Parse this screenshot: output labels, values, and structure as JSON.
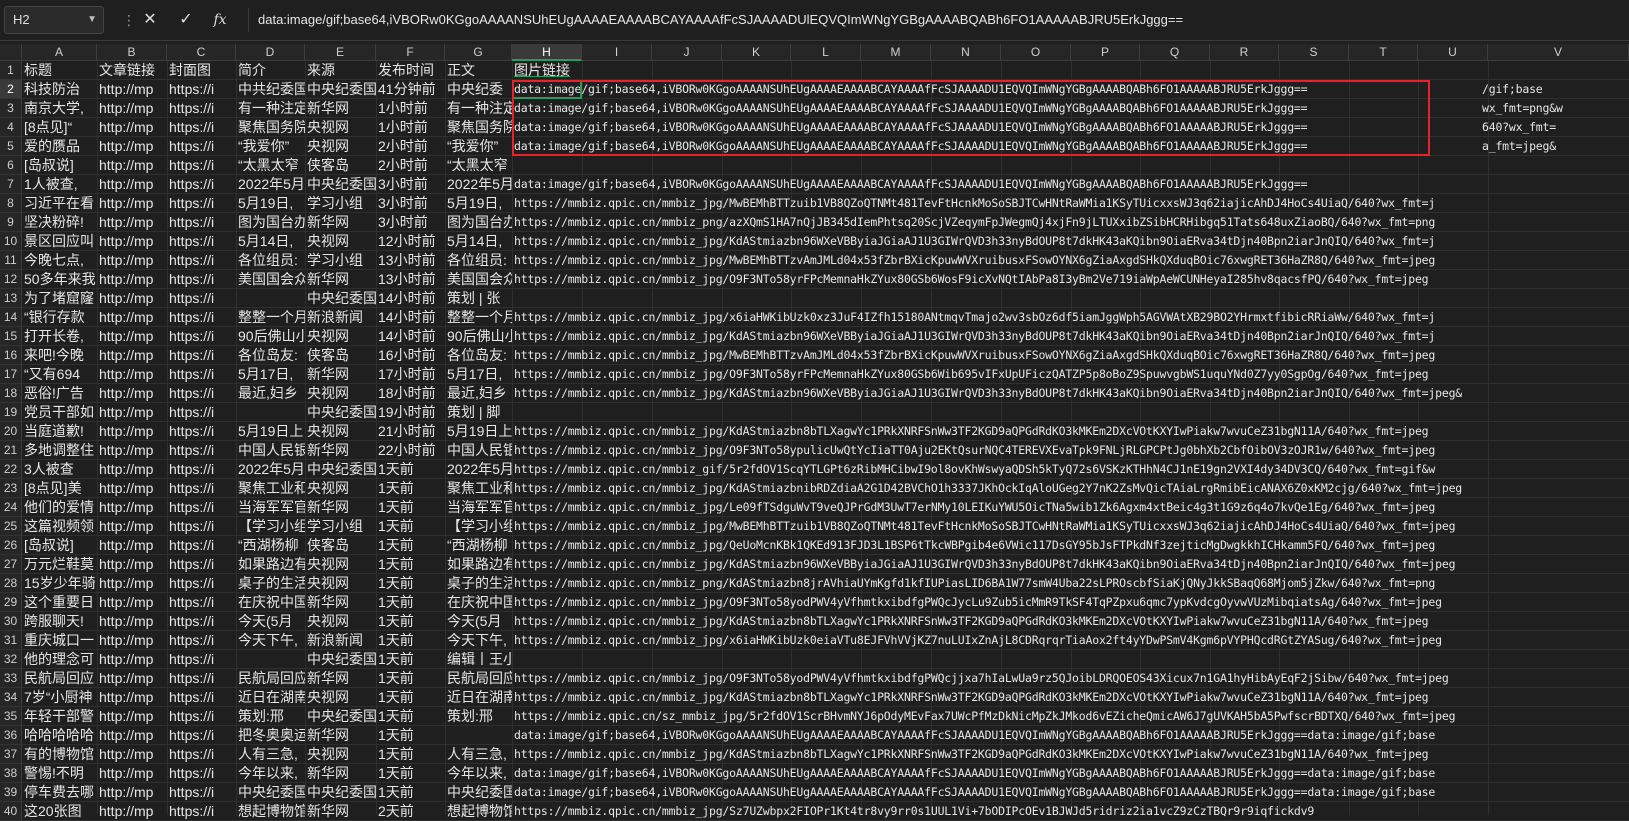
{
  "name_box": {
    "value": "H2"
  },
  "formula_bar": {
    "content": "data:image/gif;base64,iVBORw0KGgoAAAANSUhEUgAAAAEAAAABCAYAAAAfFcSJAAAADUlEQVQImWNgYGBgAAAABQABh6FO1AAAAABJRU5ErkJggg==",
    "cancel_icon": "close-icon",
    "enter_icon": "check-icon",
    "function_icon": "fx-icon"
  },
  "columns": [
    "A",
    "B",
    "C",
    "D",
    "E",
    "F",
    "G",
    "H",
    "I",
    "J",
    "K",
    "L",
    "M",
    "N",
    "O",
    "P",
    "Q",
    "R",
    "S",
    "T",
    "U",
    "V"
  ],
  "selected_column": "H",
  "highlight_color": "#e8222a",
  "selection_color": "#2e9a57",
  "rows": [
    {
      "n": "1",
      "a": "标题",
      "b": "文章链接",
      "c": "封面图",
      "d": "简介",
      "e": "来源",
      "f": "发布时间",
      "g": "正文",
      "h": "图片链接",
      "v": ""
    },
    {
      "n": "2",
      "a": "科技防治",
      "b": "http://mp",
      "c": "https://i",
      "d": "中共纪委国",
      "e": "中央纪委国",
      "f": "41分钟前",
      "g": "中央纪委",
      "h": "data:image/gif;base64,iVBORw0KGgoAAAANSUhEUgAAAAEAAAABCAYAAAAfFcSJAAAADU1EQVQImWNgYGBgAAAABQABh6FO1AAAAABJRU5ErkJggg==",
      "v": "/gif;base"
    },
    {
      "n": "3",
      "a": "南京大学,",
      "b": "http://mp",
      "c": "https://i",
      "d": "有一种注定",
      "e": "新华网",
      "f": "1小时前",
      "g": "有一种注定",
      "h": "data:image/gif;base64,iVBORw0KGgoAAAANSUhEUgAAAAEAAAABCAYAAAAfFcSJAAAADU1EQVQImWNgYGBgAAAABQABh6FO1AAAAABJRU5ErkJggg==",
      "v": "wx_fmt=png&w"
    },
    {
      "n": "4",
      "a": "[8点见]“",
      "b": "http://mp",
      "c": "https://i",
      "d": "聚焦国务院",
      "e": "央视网",
      "f": "1小时前",
      "g": "聚焦国务院",
      "h": "data:image/gif;base64,iVBORw0KGgoAAAANSUhEUgAAAAEAAAABCAYAAAAfFcSJAAAADU1EQVQImWNgYGBgAAAABQABh6FO1AAAAABJRU5ErkJggg==",
      "v": "640?wx_fmt="
    },
    {
      "n": "5",
      "a": "爱的赝品",
      "b": "http://mp",
      "c": "https://i",
      "d": "“我爱你”",
      "e": "央视网",
      "f": "2小时前",
      "g": "“我爱你”",
      "h": "data:image/gif;base64,iVBORw0KGgoAAAANSUhEUgAAAAEAAAABCAYAAAAfFcSJAAAADU1EQVQImWNgYGBgAAAABQABh6FO1AAAAABJRU5ErkJggg==",
      "v": "a_fmt=jpeg&"
    },
    {
      "n": "6",
      "a": "[岛叔说]",
      "b": "http://mp",
      "c": "https://i",
      "d": "“太黑太窄",
      "e": "侠客岛",
      "f": "2小时前",
      "g": "“太黑太窄",
      "h": "",
      "v": ""
    },
    {
      "n": "7",
      "a": "1人被查,",
      "b": "http://mp",
      "c": "https://i",
      "d": "2022年5月",
      "e": "中央纪委国",
      "f": "3小时前",
      "g": "2022年5月",
      "h": "data:image/gif;base64,iVBORw0KGgoAAAANSUhEUgAAAAEAAAABCAYAAAAfFcSJAAAADU1EQVQImWNgYGBgAAAABQABh6FO1AAAAABJRU5ErkJggg==",
      "v": ""
    },
    {
      "n": "8",
      "a": "习近平在看",
      "b": "http://mp",
      "c": "https://i",
      "d": "5月19日,",
      "e": "学习小组",
      "f": "3小时前",
      "g": "5月19日,",
      "h": "https://mmbiz.qpic.cn/mmbiz_jpg/MwBEMhBTTzuib1VB8QZoQTNMt481TevFtHcnkMoSoSBJTCwHNtRaWMia1KSyTUicxxsWJ3q62iajicAhDJ4HoCs4UiaQ/640?wx_fmt=j",
      "v": ""
    },
    {
      "n": "9",
      "a": "坚决粉碎!",
      "b": "http://mp",
      "c": "https://i",
      "d": "图为国台办",
      "e": "新华网",
      "f": "3小时前",
      "g": "图为国台办",
      "h": "https://mmbiz.qpic.cn/mmbiz_png/azXQmS1HA7nQjJB345dIemPhtsq20ScjVZeqymFpJWegmQj4xjFn9jLTUXxibZSibHCRHibgq51Tats648uxZiaoBQ/640?wx_fmt=png",
      "v": ""
    },
    {
      "n": "10",
      "a": "景区回应叫",
      "b": "http://mp",
      "c": "https://i",
      "d": "5月14日,",
      "e": "央视网",
      "f": "12小时前",
      "g": "5月14日,",
      "h": "https://mmbiz.qpic.cn/mmbiz_jpg/KdAStmiazbn96WXeVBByiaJGiaAJ1U3GIWrQVD3h33nyBdOUP8t7dkHK43aKQibn9OiaERva34tDjn40Bpn2iarJnQIQ/640?wx_fmt=j",
      "v": ""
    },
    {
      "n": "11",
      "a": "今晚七点,",
      "b": "http://mp",
      "c": "https://i",
      "d": "各位组员:",
      "e": "学习小组",
      "f": "13小时前",
      "g": "各位组员:",
      "h": "https://mmbiz.qpic.cn/mmbiz_jpg/MwBEMhBTTzvAmJMLd04x53fZbrBXicKpuwWVXruibusxFSowOYNX6gZiaAxgdSHkQXduqBOic76xwgRET36HaZR8Q/640?wx_fmt=jpeg",
      "v": ""
    },
    {
      "n": "12",
      "a": "50多年来我",
      "b": "http://mp",
      "c": "https://i",
      "d": "美国国会众",
      "e": "新华网",
      "f": "13小时前",
      "g": "美国国会众",
      "h": "https://mmbiz.qpic.cn/mmbiz_jpg/O9F3NTo58yrFPcMemnaHkZYux80GSb6WosF9icXvNQtIAbPa8I3yBm2Ve719iaWpAeWCUNHeyaI285hv8qacsfPQ/640?wx_fmt=jpeg",
      "v": ""
    },
    {
      "n": "13",
      "a": "为了堵窟窿",
      "b": "http://mp",
      "c": "https://i",
      "d": "",
      "e": "中央纪委国",
      "f": "14小时前",
      "g": "策划 | 张",
      "h": "",
      "v": ""
    },
    {
      "n": "14",
      "a": "“银行存款",
      "b": "http://mp",
      "c": "https://i",
      "d": "整整一个月",
      "e": "新浪新闻",
      "f": "14小时前",
      "g": "整整一个月",
      "h": "https://mmbiz.qpic.cn/mmbiz_jpg/x6iaHWKibUzk0xz3JuF4IZfh15180ANtmqvTmajo2wv3sbOz6df5iamJggWph5AGVWAtXB29BO2YHrmxtfibicRRiaWw/640?wx_fmt=j",
      "v": ""
    },
    {
      "n": "15",
      "a": "打开长卷,",
      "b": "http://mp",
      "c": "https://i",
      "d": "90后佛山小",
      "e": "央视网",
      "f": "14小时前",
      "g": "90后佛山小",
      "h": "https://mmbiz.qpic.cn/mmbiz_jpg/KdAStmiazbn96WXeVBByiaJGiaAJ1U3GIWrQVD3h33nyBdOUP8t7dkHK43aKQibn9OiaERva34tDjn40Bpn2iarJnQIQ/640?wx_fmt=j",
      "v": ""
    },
    {
      "n": "16",
      "a": "来吧!今晚",
      "b": "http://mp",
      "c": "https://i",
      "d": "各位岛友:",
      "e": "侠客岛",
      "f": "16小时前",
      "g": "各位岛友:",
      "h": "https://mmbiz.qpic.cn/mmbiz_jpg/MwBEMhBTTzvAmJMLd04x53fZbrBXicKpuwWVXruibusxFSowOYNX6gZiaAxgdSHkQXduqBOic76xwgRET36HaZR8Q/640?wx_fmt=jpeg",
      "v": ""
    },
    {
      "n": "17",
      "a": "“又有694",
      "b": "http://mp",
      "c": "https://i",
      "d": "5月17日,",
      "e": "新华网",
      "f": "17小时前",
      "g": "5月17日,",
      "h": "https://mmbiz.qpic.cn/mmbiz_jpg/O9F3NTo58yrFPcMemnaHkZYux80GSb6Wib695vIFxUpUFiczQATZP5p8oBoZ9SpuwvgbWS1uquYNd0Z7yy0SgpOg/640?wx_fmt=jpeg",
      "v": ""
    },
    {
      "n": "18",
      "a": "恶俗!广告",
      "b": "http://mp",
      "c": "https://i",
      "d": "最近,妇乡",
      "e": "央视网",
      "f": "18小时前",
      "g": "最近,妇乡",
      "h": "https://mmbiz.qpic.cn/mmbiz_jpg/KdAStmiazbn96WXeVBByiaJGiaAJ1U3GIWrQVD3h33nyBdOUP8t7dkHK43aKQibn9OiaERva34tDjn40Bpn2iarJnQIQ/640?wx_fmt=jpeg&",
      "v": ""
    },
    {
      "n": "19",
      "a": "党员干部如",
      "b": "http://mp",
      "c": "https://i",
      "d": "",
      "e": "中央纪委国",
      "f": "19小时前",
      "g": "策划 | 脚",
      "h": "",
      "v": ""
    },
    {
      "n": "20",
      "a": "当庭道歉!",
      "b": "http://mp",
      "c": "https://i",
      "d": "5月19日上",
      "e": "央视网",
      "f": "21小时前",
      "g": "5月19日上",
      "h": "https://mmbiz.qpic.cn/mmbiz_jpg/KdAStmiazbn8bTLXagwYc1PRkXNRFSnWw3TF2KGD9aQPGdRdKO3kMKEm2DXcVOtKXYIwPiakw7wvuCeZ31bgN11A/640?wx_fmt=jpeg",
      "v": ""
    },
    {
      "n": "21",
      "a": "多地调整住",
      "b": "http://mp",
      "c": "https://i",
      "d": "中国人民银",
      "e": "新华网",
      "f": "22小时前",
      "g": "中国人民银",
      "h": "https://mmbiz.qpic.cn/mmbiz_jpg/O9F3NTo58ypulicUwQtYcIiaTT0Aju2EKtQsurNQC4TEREVXEvaTpk9FNLjRLGPCPtJg0bhXb2CbfOibOV3zOJR1w/640?wx_fmt=jpeg",
      "v": ""
    },
    {
      "n": "22",
      "a": "3人被查",
      "b": "http://mp",
      "c": "https://i",
      "d": "2022年5月",
      "e": "中央纪委国",
      "f": "1天前",
      "g": "2022年5月",
      "h": "https://mmbiz.qpic.cn/mmbiz_gif/5r2fdOV1ScqYTLGPt6zRibMHCibwI9ol8ovKhWswyaQDSh5kTyQ72s6VSKzKTHhN4CJ1nE19gn2VXI4dy34DV3CQ/640?wx_fmt=gif&w",
      "v": ""
    },
    {
      "n": "23",
      "a": "[8点见]美",
      "b": "http://mp",
      "c": "https://i",
      "d": "聚焦工业和",
      "e": "央视网",
      "f": "1天前",
      "g": "聚焦工业和",
      "h": "https://mmbiz.qpic.cn/mmbiz_jpg/KdAStmiazbnibRDZdiaA2G1D42BVChO1h3337JKhOckIqAloUGeg2Y7nK2ZsMvQicTAiaLrgRmibEicANAX6Z0xKM2cjg/640?wx_fmt=jpeg",
      "v": ""
    },
    {
      "n": "24",
      "a": "他们的爱情",
      "b": "http://mp",
      "c": "https://i",
      "d": "当海军军官",
      "e": "新华网",
      "f": "1天前",
      "g": "当海军军官",
      "h": "https://mmbiz.qpic.cn/mmbiz_jpg/Le09fTSdguWvT9veQJPrGdM3UwT7erNMy10LEIKuYWU5OicTNa5wib1Zk6Agxm4xtBeic4g3t1G9z6q4o7kvQe1Eg/640?wx_fmt=jpeg",
      "v": ""
    },
    {
      "n": "25",
      "a": "这篇视频领",
      "b": "http://mp",
      "c": "https://i",
      "d": "【学习小组",
      "e": "学习小组",
      "f": "1天前",
      "g": "【学习小组",
      "h": "https://mmbiz.qpic.cn/mmbiz_jpg/MwBEMhBTTzuib1VB8QZoQTNMt481TevFtHcnkMoSoSBJTCwHNtRaWMia1KSyTUicxxsWJ3q62iajicAhDJ4HoCs4UiaQ/640?wx_fmt=jpeg",
      "v": ""
    },
    {
      "n": "26",
      "a": "[岛叔说]",
      "b": "http://mp",
      "c": "https://i",
      "d": "“西湖杨柳",
      "e": "侠客岛",
      "f": "1天前",
      "g": "“西湖杨柳",
      "h": "https://mmbiz.qpic.cn/mmbiz_jpg/QeUoMcnKBk1QKEd913FJD3L1BSP6tTkcWBPgib4e6VWic117DsGY95bJsFTPkdNf3zejticMgDwgkkhICHkamm5FQ/640?wx_fmt=jpeg",
      "v": ""
    },
    {
      "n": "27",
      "a": "万元烂鞋莫",
      "b": "http://mp",
      "c": "https://i",
      "d": "如果路边有",
      "e": "央视网",
      "f": "1天前",
      "g": "如果路边有",
      "h": "https://mmbiz.qpic.cn/mmbiz_jpg/KdAStmiazbn96WXeVBByiaJGiaAJ1U3GIWrQVD3h33nyBdOUP8t7dkHK43aKQibn9OiaERva34tDjn40Bpn2iarJnQIQ/640?wx_fmt=jpeg",
      "v": ""
    },
    {
      "n": "28",
      "a": "15岁少年骑",
      "b": "http://mp",
      "c": "https://i",
      "d": "桌子的生活",
      "e": "央视网",
      "f": "1天前",
      "g": "桌子的生活",
      "h": "https://mmbiz.qpic.cn/mmbiz_png/KdAStmiazbn8jrAVhiaUYmKgfd1kfIUPiasLID6BA1W77smW4Uba22sLPROscbfSiaKjQNyJkkSBaqQ68Mjom5jZkw/640?wx_fmt=png",
      "v": ""
    },
    {
      "n": "29",
      "a": "这个重要日",
      "b": "http://mp",
      "c": "https://i",
      "d": "在庆祝中国",
      "e": "新华网",
      "f": "1天前",
      "g": "在庆祝中国",
      "h": "https://mmbiz.qpic.cn/mmbiz_jpg/O9F3NTo58yodPWV4yVfhmtkxibdfgPWQcJycLu9Zub5icMmR9TkSF4TqPZpxu6qmc7ypKvdcgOyvwVUzMibqiatsAg/640?wx_fmt=jpeg",
      "v": ""
    },
    {
      "n": "30",
      "a": "跨服聊天!",
      "b": "http://mp",
      "c": "https://i",
      "d": "今天(5月",
      "e": "央视网",
      "f": "1天前",
      "g": "今天(5月",
      "h": "https://mmbiz.qpic.cn/mmbiz_jpg/KdAStmiazbn8bTLXagwYc1PRkXNRFSnWw3TF2KGD9aQPGdRdKO3kMKEm2DXcVOtKXYIwPiakw7wvuCeZ31bgN11A/640?wx_fmt=jpeg",
      "v": ""
    },
    {
      "n": "31",
      "a": "重庆城口一",
      "b": "http://mp",
      "c": "https://i",
      "d": "今天下午,",
      "e": "新浪新闻",
      "f": "1天前",
      "g": "今天下午,",
      "h": "https://mmbiz.qpic.cn/mmbiz_jpg/x6iaHWKibUzk0eiaVTu8EJFVhVVjKZ7nuLUIxZnAjL8CDRqrqrTiaAox2ft4yYDwPSmV4Kgm6pVYPHQcdRGtZYASug/640?wx_fmt=jpeg",
      "v": ""
    },
    {
      "n": "32",
      "a": "他的理念可",
      "b": "http://mp",
      "c": "https://i",
      "d": "",
      "e": "中央纪委国",
      "f": "1天前",
      "g": "编辑丨王小",
      "h": "",
      "v": ""
    },
    {
      "n": "33",
      "a": "民航局回应",
      "b": "http://mp",
      "c": "https://i",
      "d": "民航局回应",
      "e": "新华网",
      "f": "1天前",
      "g": "民航局回应",
      "h": "https://mmbiz.qpic.cn/mmbiz_jpg/O9F3NTo58yodPWV4yVfhmtkxibdfgPWQcjjxa7hIaLwUa9rz5QJoibLDRQOEOS43Xicux7n1GA1hyHibAyEqF2jSibw/640?wx_fmt=jpeg",
      "v": ""
    },
    {
      "n": "34",
      "a": "7岁“小厨神",
      "b": "http://mp",
      "c": "https://i",
      "d": "近日在湖南",
      "e": "央视网",
      "f": "1天前",
      "g": "近日在湖南",
      "h": "https://mmbiz.qpic.cn/mmbiz_jpg/KdAStmiazbn8bTLXagwYc1PRkXNRFSnWw3TF2KGD9aQPGdRdKO3kMKEm2DXcVOtKXYIwPiakw7wvuCeZ31bgN11A/640?wx_fmt=jpeg",
      "v": ""
    },
    {
      "n": "35",
      "a": "年轻干部警",
      "b": "http://mp",
      "c": "https://i",
      "d": "策划:邢",
      "e": "中央纪委国",
      "f": "1天前",
      "g": "策划:邢",
      "h": "https://mmbiz.qpic.cn/sz_mmbiz_jpg/5r2fdOV1ScrBHvmNYJ6pOdyMEvFax7UWcPfMzDkNicMpZkJMkod6vEZicheQmicAW6J7gUVKAH5bA5PwfscrBDTXQ/640?wx_fmt=jpeg",
      "v": ""
    },
    {
      "n": "36",
      "a": "哈哈哈哈哈",
      "b": "http://mp",
      "c": "https://i",
      "d": "把冬奥奥运",
      "e": "新华网",
      "f": "1天前",
      "g": "",
      "h": "data:image/gif;base64,iVBORw0KGgoAAAANSUhEUgAAAAEAAAABCAYAAAAfFcSJAAAADU1EQVQImWNgYGBgAAAABQABh6FO1AAAAABJRU5ErkJggg==data:image/gif;base",
      "v": ""
    },
    {
      "n": "37",
      "a": "有的博物馆",
      "b": "http://mp",
      "c": "https://i",
      "d": "人有三急,",
      "e": "央视网",
      "f": "1天前",
      "g": "人有三急,",
      "h": "https://mmbiz.qpic.cn/mmbiz_jpg/KdAStmiazbn8bTLXagwYc1PRkXNRFSnWw3TF2KGD9aQPGdRdKO3kMKEm2DXcVOtKXYIwPiakw7wvuCeZ31bgN11A/640?wx_fmt=jpeg",
      "v": ""
    },
    {
      "n": "38",
      "a": "警惕!不明",
      "b": "http://mp",
      "c": "https://i",
      "d": "今年以来,",
      "e": "新华网",
      "f": "1天前",
      "g": "今年以来,",
      "h": "data:image/gif;base64,iVBORw0KGgoAAAANSUhEUgAAAAEAAAABCAYAAAAfFcSJAAAADU1EQVQImWNgYGBgAAAABQABh6FO1AAAAABJRU5ErkJggg==data:image/gif;base",
      "v": ""
    },
    {
      "n": "39",
      "a": "停车费去哪",
      "b": "http://mp",
      "c": "https://i",
      "d": "中央纪委国",
      "e": "中央纪委国",
      "f": "1天前",
      "g": "中央纪委国",
      "h": "data:image/gif;base64,iVBORw0KGgoAAAANSUhEUgAAAAEAAAABCAYAAAAfFcSJAAAADU1EQVQImWNgYGBgAAAABQABh6FO1AAAAABJRU5ErkJggg==data:image/gif;base",
      "v": ""
    },
    {
      "n": "40",
      "a": "这20张图",
      "b": "http://mp",
      "c": "https://i",
      "d": "想起博物馆",
      "e": "新华网",
      "f": "2天前",
      "g": "想起博物馆",
      "h": "https://mmbiz.qpic.cn/mmbiz_jpg/Sz7UZwbpx2FIOPr1Kt4tr8vy9rr0s1UUL1Vi+7bODIPcOEv1BJWJd5ridriz2ia1vcZ9zCzTBQr9r9iqfickdv9",
      "v": ""
    }
  ]
}
